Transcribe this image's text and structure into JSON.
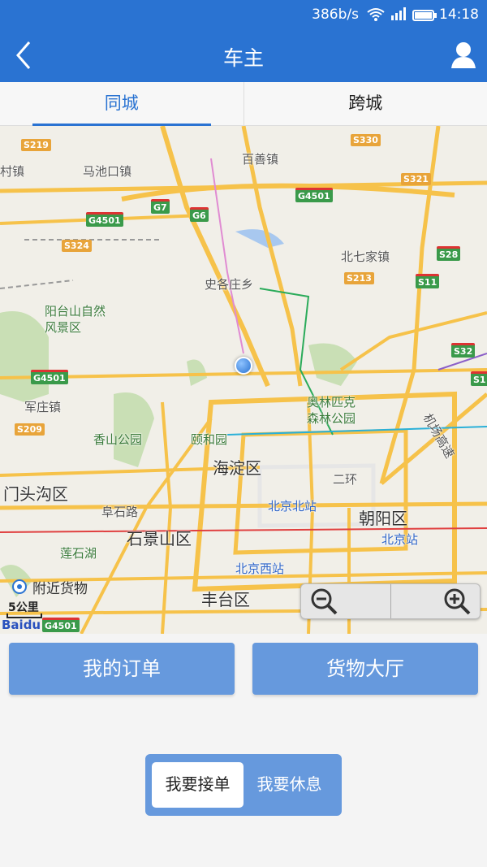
{
  "status_bar": {
    "speed": "386b/s",
    "time": "14:18"
  },
  "header": {
    "title": "车主",
    "back_icon": "chevron-left-icon",
    "user_icon": "user-icon"
  },
  "tabs": [
    {
      "label": "同城",
      "active": true
    },
    {
      "label": "跨城",
      "active": false
    }
  ],
  "map": {
    "labels": {
      "baishan": "百善镇",
      "machikou": "马池口镇",
      "cunzhen": "村镇",
      "beiqijia": "北七家镇",
      "shigezhuang": "史各庄乡",
      "yangtaishan": "阳台山自然风景区",
      "junzhuang": "军庄镇",
      "olympic": "奥林匹克森林公园",
      "xiangshan": "香山公园",
      "yiheyuan": "颐和园",
      "haidian": "海淀区",
      "mentougou": "门头沟区",
      "fushilu": "阜石路",
      "shijingshan": "石景山区",
      "lianshihu": "莲石湖",
      "beijingbei": "北京北站",
      "beijing": "北京站",
      "beijingxi": "北京西站",
      "chaoyang": "朝阳区",
      "fengtai": "丰台区",
      "erhuan": "二环",
      "airport": "机场高速"
    },
    "shields": {
      "s219": "S219",
      "s330": "S330",
      "s321": "S321",
      "g4501a": "G4501",
      "g7": "G7",
      "g6": "G6",
      "g4501b": "G4501",
      "s324": "S324",
      "s28": "S28",
      "s213": "S213",
      "s11": "S11",
      "s32": "S32",
      "g4501c": "G4501",
      "s209": "S209",
      "s1": "S1",
      "g4501d": "G4501"
    },
    "nearby_cargo": "附近货物",
    "scale": "5公里",
    "logo": "Baidu",
    "zoom_out_icon": "zoom-out-icon",
    "zoom_in_icon": "zoom-in-icon"
  },
  "actions": {
    "my_orders": "我的订单",
    "cargo_hall": "货物大厅"
  },
  "work_toggle": {
    "accept": "我要接单",
    "rest": "我要休息",
    "selected": "accept"
  },
  "colors": {
    "primary": "#2a73d2",
    "button": "#6699dd"
  }
}
